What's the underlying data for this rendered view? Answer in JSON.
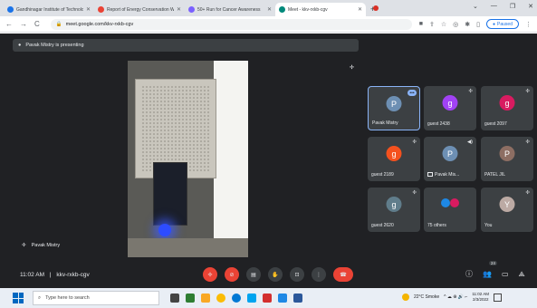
{
  "browser": {
    "tabs": [
      {
        "title": "Gandhinagar Institute of Technology",
        "color": "#1a73e8",
        "active": false
      },
      {
        "title": "Report of Energy Conservation W",
        "color": "#ea4335",
        "active": false
      },
      {
        "title": "50+ Run for Cancer Awareness",
        "color": "#7b61ff",
        "active": false
      },
      {
        "title": "Meet - kkv-rxkb-cgv",
        "color": "#00897b",
        "active": true
      }
    ],
    "url": "meet.google.com/kkv-rxkb-cgv",
    "profile_label": "Paused"
  },
  "meet": {
    "presenting_text": "Pavak Mistry is presenting",
    "self_name": "Pavak Mistry",
    "time": "11:02 AM",
    "separator": "|",
    "meeting_code": "kkv-rxkb-cgv",
    "participants_badge": "24",
    "tiles": [
      {
        "name": "Pavak Mistry",
        "avatar": "P",
        "color": "#6d8fb3",
        "highlight": true
      },
      {
        "name": "guest 2438",
        "avatar": "g",
        "color": "#a142f4",
        "highlight": false
      },
      {
        "name": "guest 2097",
        "avatar": "g",
        "color": "#d81b60",
        "highlight": false
      },
      {
        "name": "guest 2189",
        "avatar": "g",
        "color": "#f4511e",
        "highlight": false
      },
      {
        "name": "Pavak Mis...",
        "avatar": "P",
        "color": "#6d8fb3",
        "highlight": false
      },
      {
        "name": "PATEL JIL",
        "avatar": "P",
        "color": "#8d6e63",
        "highlight": false
      },
      {
        "name": "guest 2620",
        "avatar": "g",
        "color": "#607d8b",
        "highlight": false
      },
      {
        "name": "75 others",
        "avatar": "",
        "color": "#1e88e5",
        "highlight": false
      },
      {
        "name": "You",
        "avatar": "Y",
        "color": "#bcaaa4",
        "highlight": false
      }
    ]
  },
  "taskbar": {
    "search_placeholder": "Type here to search",
    "weather": "22°C  Smoke",
    "clock_time": "11:02 AM",
    "clock_date": "2/3/2022"
  }
}
